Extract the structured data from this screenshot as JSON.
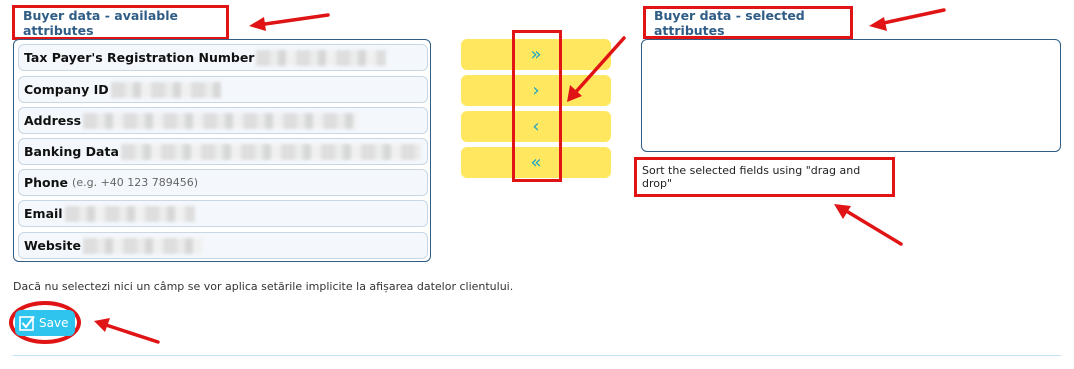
{
  "available": {
    "title": "Buyer data - available attributes",
    "items": [
      {
        "label": "Tax Payer's Registration Number",
        "hint": ""
      },
      {
        "label": "Company ID",
        "hint": ""
      },
      {
        "label": "Address",
        "hint": ""
      },
      {
        "label": "Banking Data",
        "hint": ""
      },
      {
        "label": "Phone",
        "hint": "(e.g. +40 123 789456)"
      },
      {
        "label": "Email",
        "hint": ""
      },
      {
        "label": "Website",
        "hint": ""
      }
    ]
  },
  "selected": {
    "title": "Buyer data - selected attributes",
    "sort_hint": "Sort the selected fields using \"drag and drop\""
  },
  "controls": {
    "move_all_right": "»",
    "move_right": "›",
    "move_left": "‹",
    "move_all_left": "«"
  },
  "note": "Dacă nu selectezi nici un câmp se vor aplica setările implicite la afișarea datelor clientului.",
  "save_label": "Save",
  "colors": {
    "accent": "#2fc4ee",
    "button_yellow": "#ffe860",
    "title_blue": "#2f5d86",
    "annotation_red": "#e01414"
  }
}
